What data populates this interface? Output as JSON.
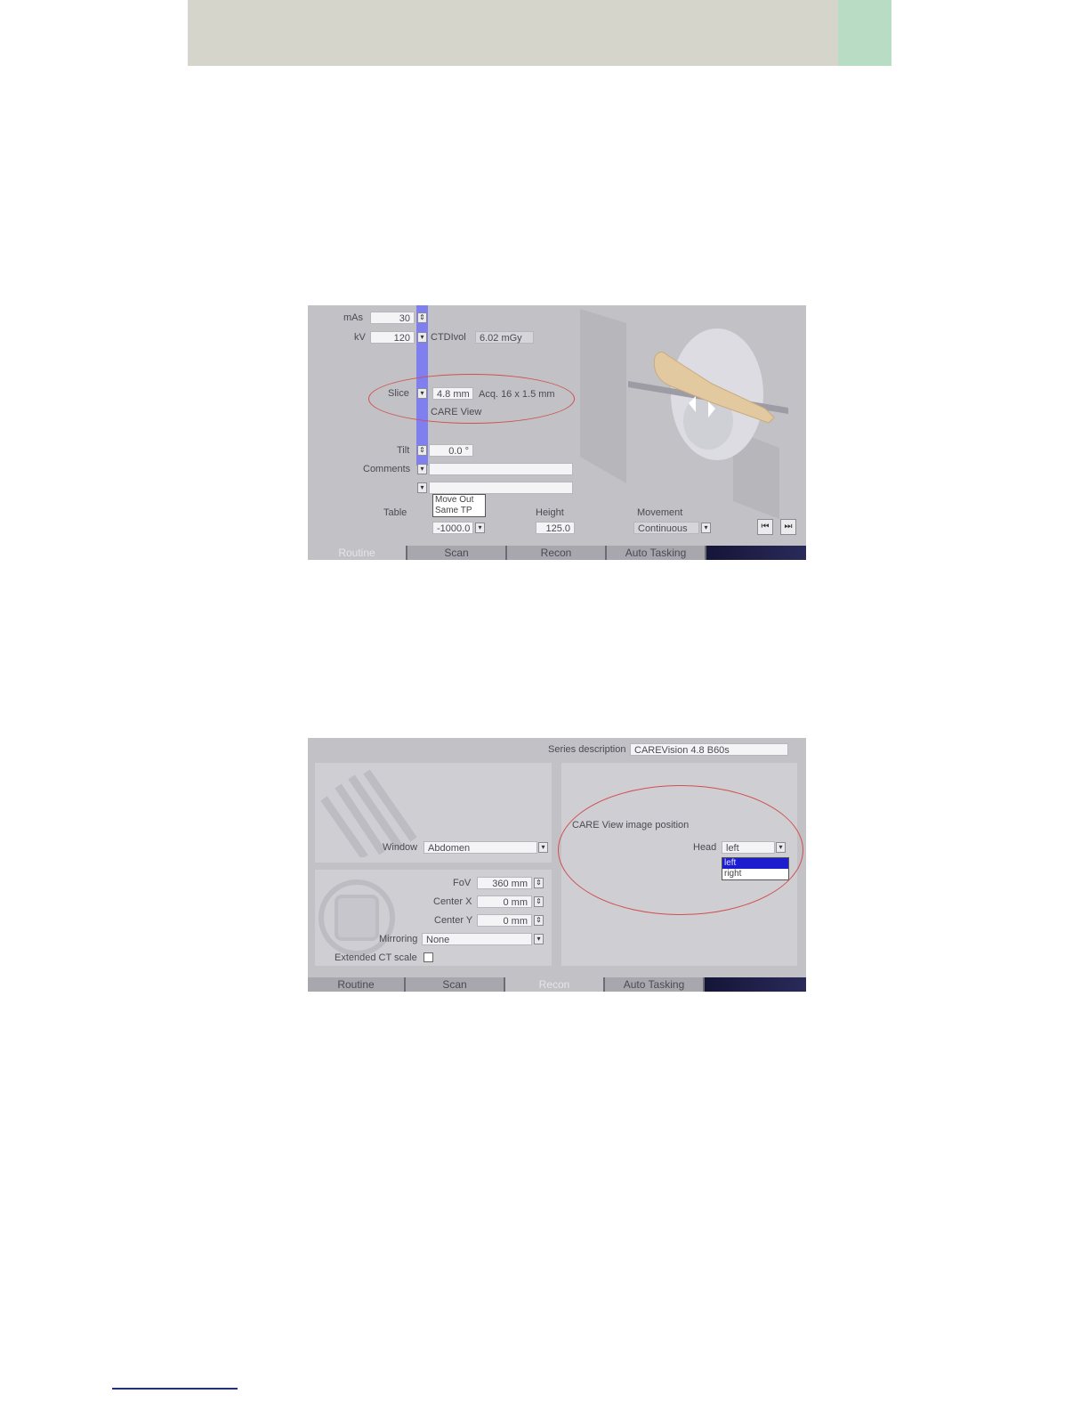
{
  "panel1": {
    "mas_label": "mAs",
    "mas_value": "30",
    "kv_label": "kV",
    "kv_value": "120",
    "ctdi_label": "CTDIvol",
    "ctdi_value": "6.02 mGy",
    "slice_label": "Slice",
    "slice_value": "4.8 mm",
    "acq_text": "Acq. 16 x 1.5 mm",
    "care_view": "CARE View",
    "tilt_label": "Tilt",
    "tilt_value": "0.0 °",
    "comments_label": "Comments",
    "table_label": "Table",
    "table_menu": [
      "Move Out",
      "Same TP"
    ],
    "table_value": "-1000.0",
    "height_label": "Height",
    "height_value": "125.0",
    "movement_label": "Movement",
    "movement_value": "Continuous",
    "tabs": [
      "Routine",
      "Scan",
      "Recon",
      "Auto Tasking"
    ],
    "active_tab": "Routine"
  },
  "panel2": {
    "series_label": "Series description",
    "series_value": "CAREVision  4.8  B60s",
    "window_label": "Window",
    "window_value": "Abdomen",
    "fov_label": "FoV",
    "fov_value": "360 mm",
    "centerx_label": "Center X",
    "centerx_value": "0 mm",
    "centery_label": "Center Y",
    "centery_value": "0 mm",
    "mirroring_label": "Mirroring",
    "mirroring_value": "None",
    "extended_label": "Extended CT scale",
    "careview_position": "CARE View image position",
    "head_label": "Head",
    "head_value": "left",
    "head_options": [
      "left",
      "right"
    ],
    "tabs": [
      "Routine",
      "Scan",
      "Recon",
      "Auto Tasking"
    ],
    "active_tab": "Recon"
  }
}
